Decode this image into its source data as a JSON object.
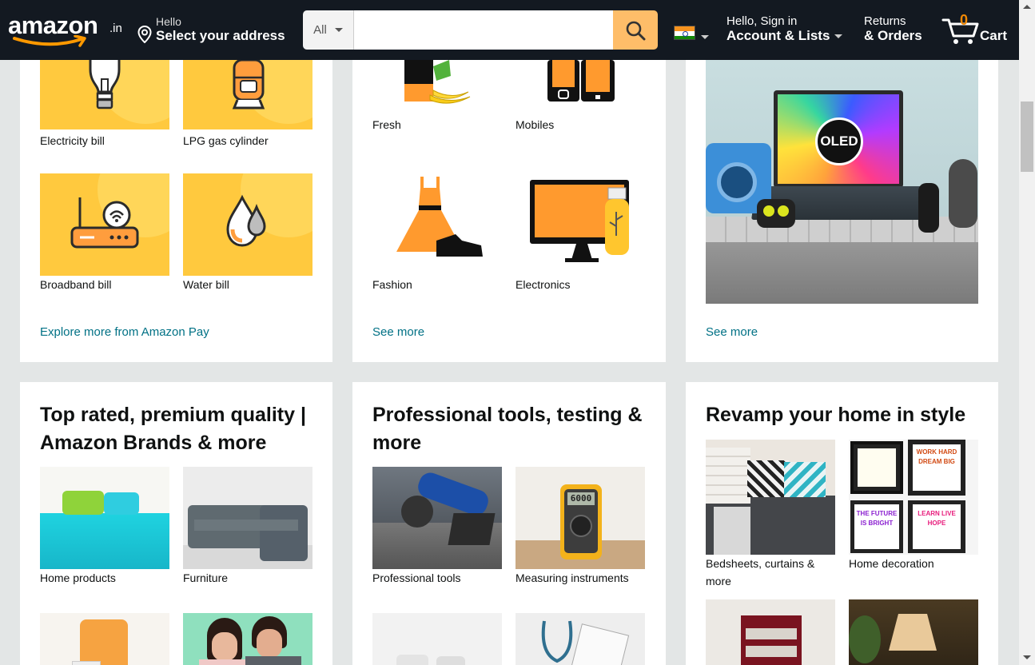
{
  "header": {
    "logo_text": "amazon",
    "logo_tld": ".in",
    "address_hello": "Hello",
    "address_select": "Select your address",
    "search_category": "All",
    "search_placeholder": "",
    "account_hello": "Hello, Sign in",
    "account_lists": "Account & Lists",
    "returns": "Returns",
    "orders": "& Orders",
    "cart_count": "0",
    "cart_label": "Cart",
    "brand_color": "#131921",
    "accent_color": "#febd69"
  },
  "cards": {
    "pay": {
      "tiles": [
        {
          "caption": "Electricity bill",
          "icon": "bulb-icon"
        },
        {
          "caption": "LPG gas cylinder",
          "icon": "gas-cylinder-icon"
        },
        {
          "caption": "Broadband bill",
          "icon": "router-icon"
        },
        {
          "caption": "Water bill",
          "icon": "water-drop-icon"
        }
      ],
      "link": "Explore more from Amazon Pay"
    },
    "categories": {
      "tiles": [
        {
          "caption": "Fresh",
          "icon": "fresh-produce-icon"
        },
        {
          "caption": "Mobiles",
          "icon": "mobile-phones-icon"
        },
        {
          "caption": "Fashion",
          "icon": "dress-shoe-icon"
        },
        {
          "caption": "Electronics",
          "icon": "monitor-usb-icon"
        }
      ],
      "link": "See more"
    },
    "laptop": {
      "image_label": "OLED",
      "link": "See more"
    },
    "brands": {
      "title": "Top rated, premium quality | Amazon Brands & more",
      "tiles": [
        {
          "caption": "Home products"
        },
        {
          "caption": "Furniture"
        }
      ]
    },
    "tools": {
      "title": "Professional tools, testing & more",
      "tiles": [
        {
          "caption": "Professional tools"
        },
        {
          "caption": "Measuring instruments"
        }
      ],
      "meter_reading": "6000"
    },
    "home": {
      "title": "Revamp your home in style",
      "tiles": [
        {
          "caption": "Bedsheets, curtains & more"
        },
        {
          "caption": "Home decoration"
        }
      ],
      "posters": [
        "WORK HARD DREAM BIG",
        "THE FUTURE IS BRIGHT",
        "LEARN LIVE HOPE"
      ]
    }
  }
}
